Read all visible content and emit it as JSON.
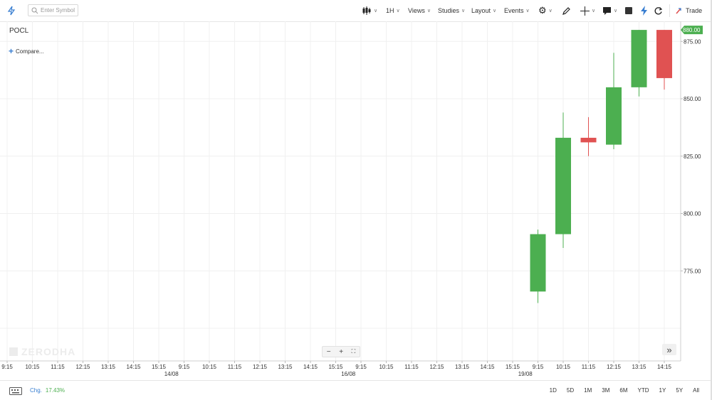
{
  "toolbar": {
    "search_placeholder": "Enter Symbol",
    "interval": "1H",
    "views": "Views",
    "studies": "Studies",
    "layout": "Layout",
    "events": "Events",
    "trade": "Trade"
  },
  "symbol": "POCL",
  "compare": "Compare...",
  "watermark": "ZERODHA",
  "footer": {
    "chg_label": "Chg.",
    "chg_value": "17.43%",
    "ranges": [
      "1D",
      "5D",
      "1M",
      "3M",
      "6M",
      "YTD",
      "1Y",
      "5Y",
      "All"
    ]
  },
  "colors": {
    "up": "#4caf50",
    "down": "#e05252",
    "accent": "#387ed1"
  },
  "chart_data": {
    "type": "candlestick",
    "x_ticks": [
      "9:15",
      "10:15",
      "11:15",
      "12:15",
      "13:15",
      "14:15",
      "15:15",
      "9:15",
      "10:15",
      "11:15",
      "12:15",
      "13:15",
      "14:15",
      "15:15",
      "9:15",
      "10:15",
      "11:15",
      "12:15",
      "13:15",
      "14:15",
      "15:15",
      "9:15",
      "10:15",
      "11:15",
      "12:15",
      "13:15",
      "14:15"
    ],
    "date_labels": [
      {
        "label": "14/08",
        "after_tick": 6
      },
      {
        "label": "16/08",
        "after_tick": 13
      },
      {
        "label": "19/08",
        "after_tick": 20
      }
    ],
    "y_ticks": [
      775,
      800,
      825,
      850,
      875
    ],
    "ylim": [
      758,
      900
    ],
    "last_price": "880.00",
    "last_price_value": 880,
    "candles": [
      {
        "time": "19/08 9:15",
        "open": 766,
        "high": 793,
        "low": 761,
        "close": 791
      },
      {
        "time": "19/08 10:15",
        "open": 791,
        "high": 844,
        "low": 785,
        "close": 833
      },
      {
        "time": "19/08 11:15",
        "open": 833,
        "high": 842,
        "low": 825,
        "close": 831
      },
      {
        "time": "19/08 12:15",
        "open": 830,
        "high": 870,
        "low": 828,
        "close": 855
      },
      {
        "time": "19/08 13:15",
        "open": 855,
        "high": 880,
        "low": 851,
        "close": 880
      },
      {
        "time": "19/08 14:15",
        "open": 880,
        "high": 880,
        "low": 854,
        "close": 859
      }
    ]
  }
}
